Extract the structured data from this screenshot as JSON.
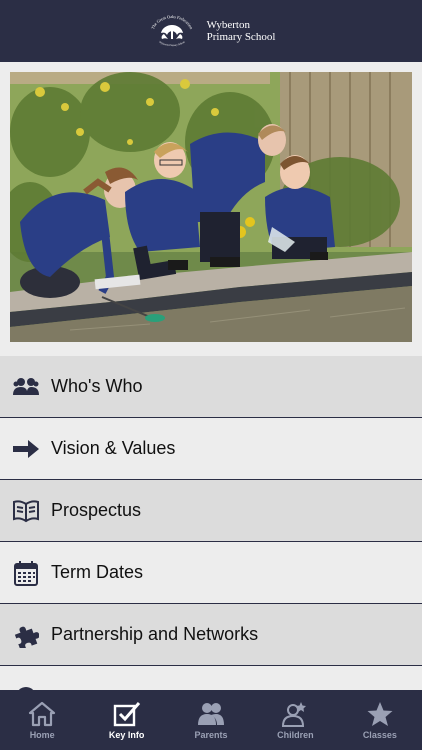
{
  "header": {
    "logo_ring_text": "The Great Oaks Federation",
    "logo_sub_text": "Wyberton Primary School",
    "school_line1": "Wyberton",
    "school_line2": "Primary School"
  },
  "menu": {
    "items": [
      {
        "label": "Who's Who",
        "icon": "people-icon"
      },
      {
        "label": "Vision & Values",
        "icon": "arrow-right-icon"
      },
      {
        "label": "Prospectus",
        "icon": "open-book-icon"
      },
      {
        "label": "Term Dates",
        "icon": "calendar-icon"
      },
      {
        "label": "Partnership and Networks",
        "icon": "puzzle-icon"
      }
    ]
  },
  "tabbar": {
    "active": "Key Info",
    "tabs": [
      {
        "label": "Home",
        "icon": "home-icon"
      },
      {
        "label": "Key Info",
        "icon": "checkbox-icon"
      },
      {
        "label": "Parents",
        "icon": "parents-icon"
      },
      {
        "label": "Children",
        "icon": "child-star-icon"
      },
      {
        "label": "Classes",
        "icon": "star-icon"
      }
    ]
  },
  "colors": {
    "header_bg": "#2b2e45",
    "row_dark": "#dcdcdc",
    "row_light": "#ededed",
    "tab_inactive": "#9aa0b4",
    "tab_active": "#ffffff"
  }
}
